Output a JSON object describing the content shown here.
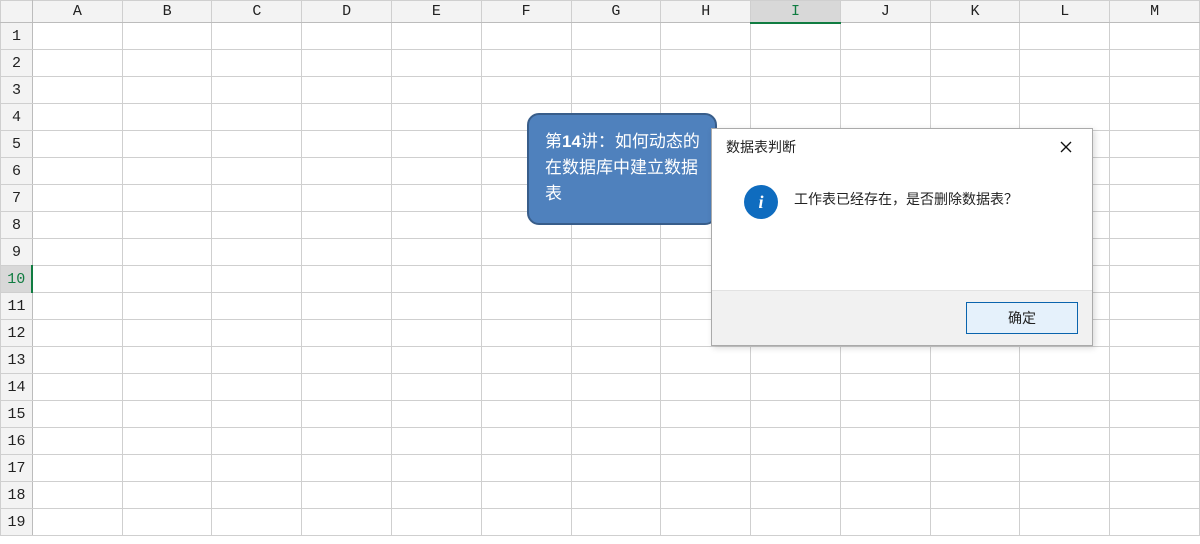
{
  "spreadsheet": {
    "columns": [
      "A",
      "B",
      "C",
      "D",
      "E",
      "F",
      "G",
      "H",
      "I",
      "J",
      "K",
      "L",
      "M"
    ],
    "rows": [
      "1",
      "2",
      "3",
      "4",
      "5",
      "6",
      "7",
      "8",
      "9",
      "10",
      "11",
      "12",
      "13",
      "14",
      "15",
      "16",
      "17",
      "18",
      "19"
    ],
    "selected_column_index": 8,
    "selected_row_index": 9
  },
  "callout": {
    "prefix": "第",
    "number": "14",
    "rest": "讲：如何动态的在数据库中建立数据表"
  },
  "dialog": {
    "title": "数据表判断",
    "message": "工作表已经存在，是否删除数据表？",
    "ok_label": "确定",
    "info_glyph": "i"
  }
}
